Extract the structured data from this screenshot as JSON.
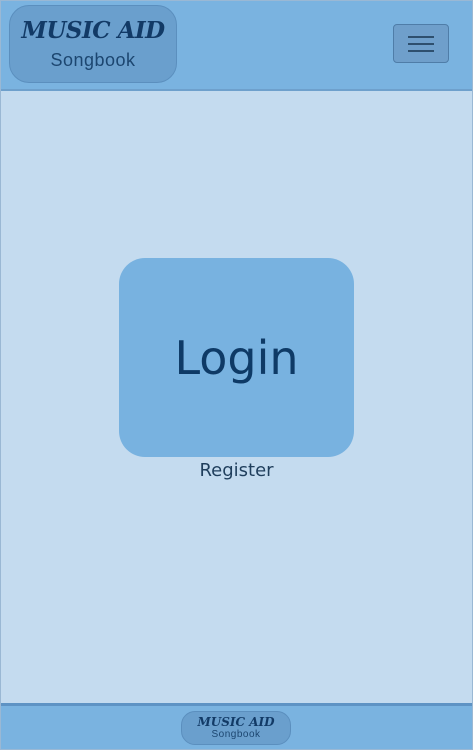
{
  "header": {
    "brand_title": "MUSIC AID",
    "brand_subtitle": "Songbook",
    "menu_icon": "hamburger-menu-icon"
  },
  "main": {
    "login_label": "Login",
    "register_label": "Register"
  },
  "footer": {
    "brand_title": "MUSIC AID",
    "brand_subtitle": "Songbook"
  },
  "colors": {
    "header_bg": "#7ab3e0",
    "page_bg": "#c4dbef",
    "brand_bg": "#6a9fcd",
    "text_dark": "#0e3a66"
  }
}
